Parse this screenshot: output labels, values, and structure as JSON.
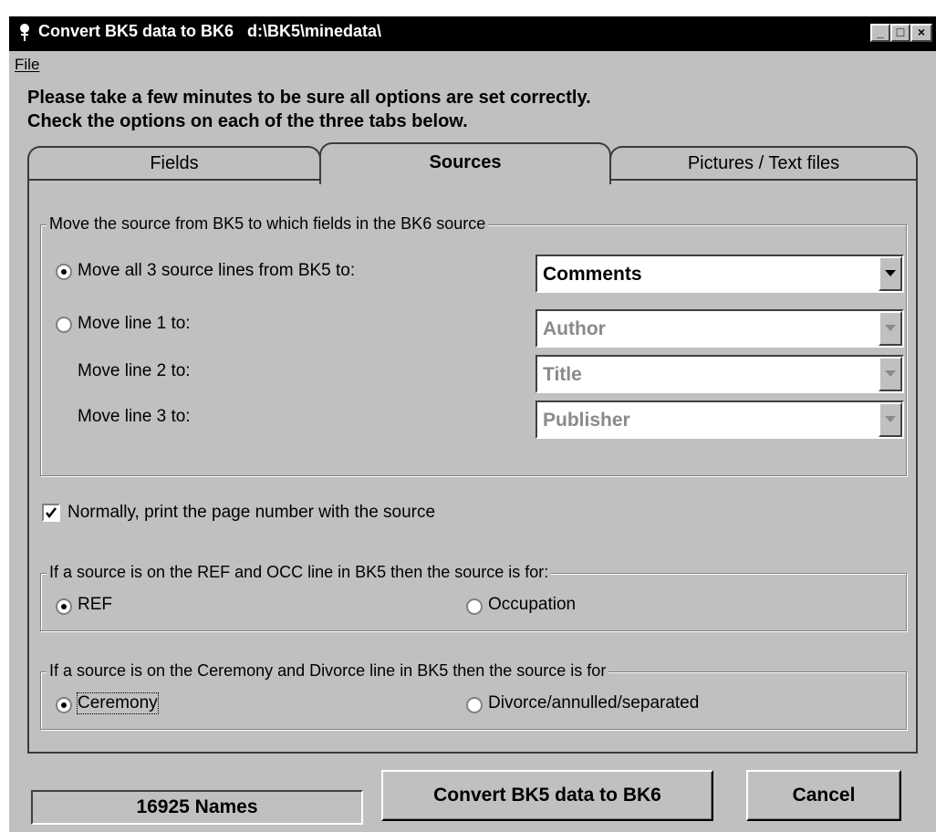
{
  "window": {
    "title": "Convert BK5 data to BK6   d:\\BK5\\minedata\\",
    "controls": {
      "minimize": "_",
      "maximize": "□",
      "close": "×"
    }
  },
  "menu": {
    "file": "File"
  },
  "instructions": {
    "line1": "Please take a few minutes to be sure all options are set correctly.",
    "line2": "Check the options on each of the three tabs below."
  },
  "tabs": [
    {
      "label": "Fields",
      "active": false
    },
    {
      "label": "Sources",
      "active": true
    },
    {
      "label": "Pictures / Text files",
      "active": false
    }
  ],
  "source_group": {
    "legend": "Move the source from BK5 to which fields in the BK6 source",
    "all_lines_label": "Move all 3 source lines from BK5 to:",
    "all_lines_value": "Comments",
    "line1_label": "Move line 1 to:",
    "line1_value": "Author",
    "line2_label": "Move line 2 to:",
    "line2_value": "Title",
    "line3_label": "Move line 3 to:",
    "line3_value": "Publisher",
    "selected": "all"
  },
  "page_number_checkbox": {
    "label": "Normally, print the page number with the source",
    "checked": true
  },
  "ref_group": {
    "legend": "If a source is on the REF and OCC line in BK5 then the source is for:",
    "option1": "REF",
    "option2": "Occupation",
    "selected": "REF"
  },
  "ceremony_group": {
    "legend": "If a source is on the Ceremony and Divorce line in BK5 then the source is for",
    "option1": "Ceremony",
    "option2": "Divorce/annulled/separated",
    "selected": "Ceremony"
  },
  "footer": {
    "names_count": "16925 Names",
    "convert_button": "Convert BK5 data to BK6",
    "cancel_button": "Cancel"
  },
  "colors": {
    "face": "#c0c0c0",
    "titlebar": "#000000",
    "disabled_text": "#8a8a8a"
  }
}
